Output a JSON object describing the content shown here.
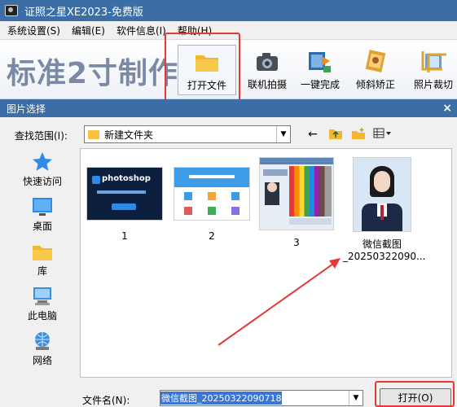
{
  "window": {
    "title": "证照之星XE2023-免费版"
  },
  "menu": [
    "系统设置(S)",
    "编辑(E)",
    "软件信息(I)",
    "帮助(H)"
  ],
  "toolbar": {
    "brand": "标准2寸制作",
    "tools": [
      {
        "label": "打开文件",
        "icon": "folder-icon"
      },
      {
        "label": "联机拍摄",
        "icon": "camera-icon"
      },
      {
        "label": "一键完成",
        "icon": "one-click-icon"
      },
      {
        "label": "倾斜矫正",
        "icon": "tilt-correct-icon"
      },
      {
        "label": "照片裁切",
        "icon": "crop-icon"
      }
    ]
  },
  "dialog": {
    "title": "图片选择",
    "close": "×",
    "lookin_label": "查找范围(I):",
    "lookin_value": "新建文件夹",
    "places": [
      {
        "label": "快速访问",
        "icon": "star-icon"
      },
      {
        "label": "桌面",
        "icon": "desktop-icon"
      },
      {
        "label": "库",
        "icon": "library-icon"
      },
      {
        "label": "此电脑",
        "icon": "computer-icon"
      },
      {
        "label": "网络",
        "icon": "network-icon"
      }
    ],
    "files": [
      {
        "caption": "1"
      },
      {
        "caption": "2"
      },
      {
        "caption": "3"
      },
      {
        "caption_line1": "微信截图",
        "caption_line2": "_20250322090..."
      }
    ],
    "thumb1_text": "photoshop",
    "filename_label": "文件名(N):",
    "filename_value": "微信截图_20250322090718",
    "open_button": "打开(O)"
  },
  "colors": {
    "titlebar": "#3b6ea5",
    "highlight": "#e53935",
    "selection": "#3875d7"
  }
}
